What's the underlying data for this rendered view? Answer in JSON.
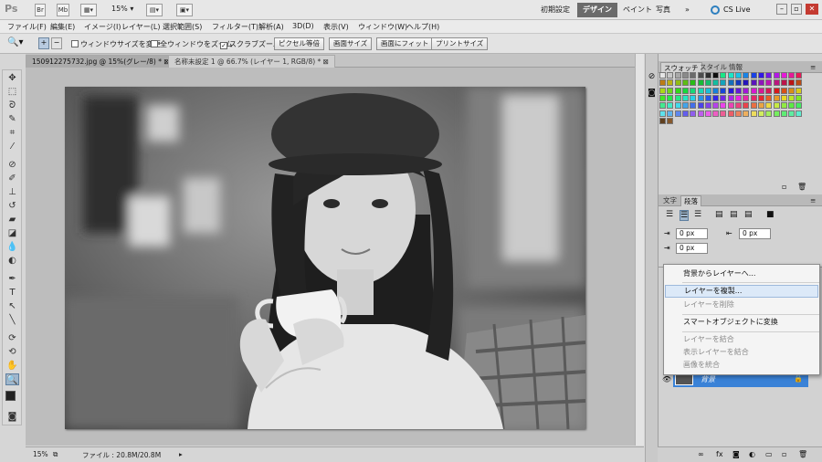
{
  "appbar": {
    "logo": "Ps",
    "br": "Br",
    "mb": "Mb",
    "zoom": "15%",
    "workspaces": [
      "初期設定",
      "デザイン",
      "ペイント",
      "写真"
    ],
    "more": "»",
    "cslive": "CS Live"
  },
  "menus": [
    "ファイル(F)",
    "編集(E)",
    "イメージ(I)",
    "レイヤー(L)",
    "選択範囲(S)",
    "フィルター(T)",
    "解析(A)",
    "3D(D)",
    "表示(V)",
    "ウィンドウ(W)",
    "ヘルプ(H)"
  ],
  "options": {
    "chk1": "ウィンドウサイズを変更",
    "chk2": "全ウィンドウをズーム",
    "chk3": "スクラブズーム",
    "b1": "ピクセル等倍",
    "b2": "画面サイズ",
    "b3": "画面にフィット",
    "b4": "プリントサイズ"
  },
  "tabs": [
    "150912275732.jpg @ 15%(グレー/8) *",
    "名称未設定 1 @ 66.7% (レイヤー 1, RGB/8) *"
  ],
  "status": {
    "zoom": "15%",
    "file": "ファイル : 20.8M/20.8M"
  },
  "panels": {
    "swatch_tabs": [
      "スウォッチ",
      "スタイル",
      "情報"
    ],
    "para_tabs": [
      "文字",
      "段落"
    ],
    "indent_left": "0 px",
    "indent_right": "0 px",
    "indent_first": "0 px"
  },
  "context_menu": [
    {
      "label": "背景からレイヤーへ...",
      "state": "normal"
    },
    {
      "label": "レイヤーを複製...",
      "state": "highlight"
    },
    {
      "label": "レイヤーを削除",
      "state": "disabled"
    },
    {
      "label": "スマートオブジェクトに変換",
      "state": "normal"
    },
    {
      "label": "レイヤーを結合",
      "state": "disabled"
    },
    {
      "label": "表示レイヤーを結合",
      "state": "disabled"
    },
    {
      "label": "画像を統合",
      "state": "disabled"
    }
  ],
  "layer": {
    "name": "背景"
  }
}
